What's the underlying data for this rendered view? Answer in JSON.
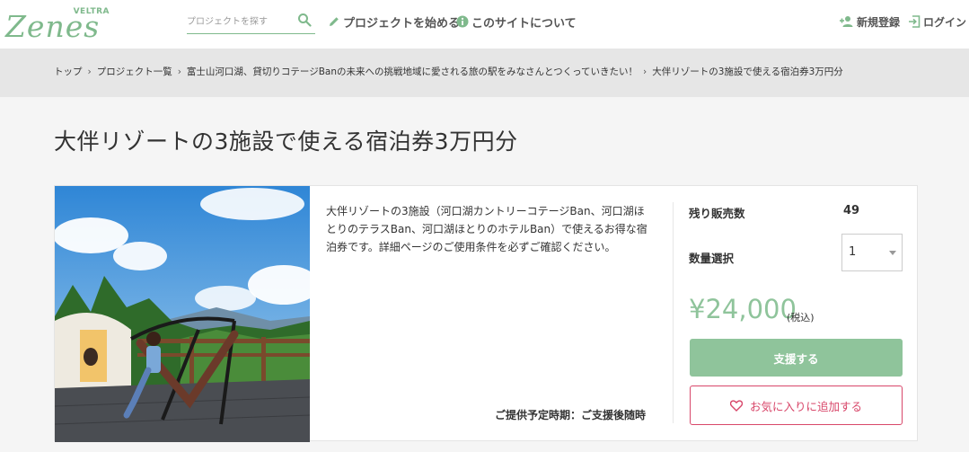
{
  "header": {
    "logo_sub": "VELTRA",
    "logo_main": "Zenes",
    "search_placeholder": "プロジェクトを探す",
    "nav": {
      "start_label": "プロジェクトを始める",
      "about_label": "このサイトについて",
      "register_label": "新規登録",
      "login_label": "ログイン"
    }
  },
  "breadcrumb": {
    "items": [
      "トップ",
      "プロジェクト一覧",
      "富士山河口湖、貸切りコテージBanの未来への挑戦地域に愛される旅の駅をみなさんとつくっていきたい！",
      "大伴リゾートの3施設で使える宿泊券3万円分"
    ],
    "separator": "›"
  },
  "page_title": "大伴リゾートの3施設で使える宿泊券3万円分",
  "product": {
    "description": "大伴リゾートの3施設（河口湖カントリーコテージBan、河口湖ほとりのテラスBan、河口湖ほとりのホテルBan）で使えるお得な宿泊券です。詳細ページのご使用条件を必ずご確認ください。",
    "delivery": "ご提供予定時期：ご支援後随時",
    "remaining_label": "残り販売数",
    "remaining_value": "49",
    "quantity_label": "数量選択",
    "quantity_value": "1",
    "price": "¥24,000",
    "tax_note": "(税込)",
    "support_button": "支援する",
    "favorite_button": "お気に入りに追加する"
  },
  "colors": {
    "brand_green": "#7fb98c",
    "button_green": "#8fc49b",
    "favorite_red": "#d8476a"
  },
  "icons": {
    "search": "search-icon",
    "start": "pencil-icon",
    "about": "info-icon",
    "register": "person-plus-icon",
    "login": "login-icon",
    "favorite": "heart-icon",
    "select": "caret-down-icon"
  }
}
